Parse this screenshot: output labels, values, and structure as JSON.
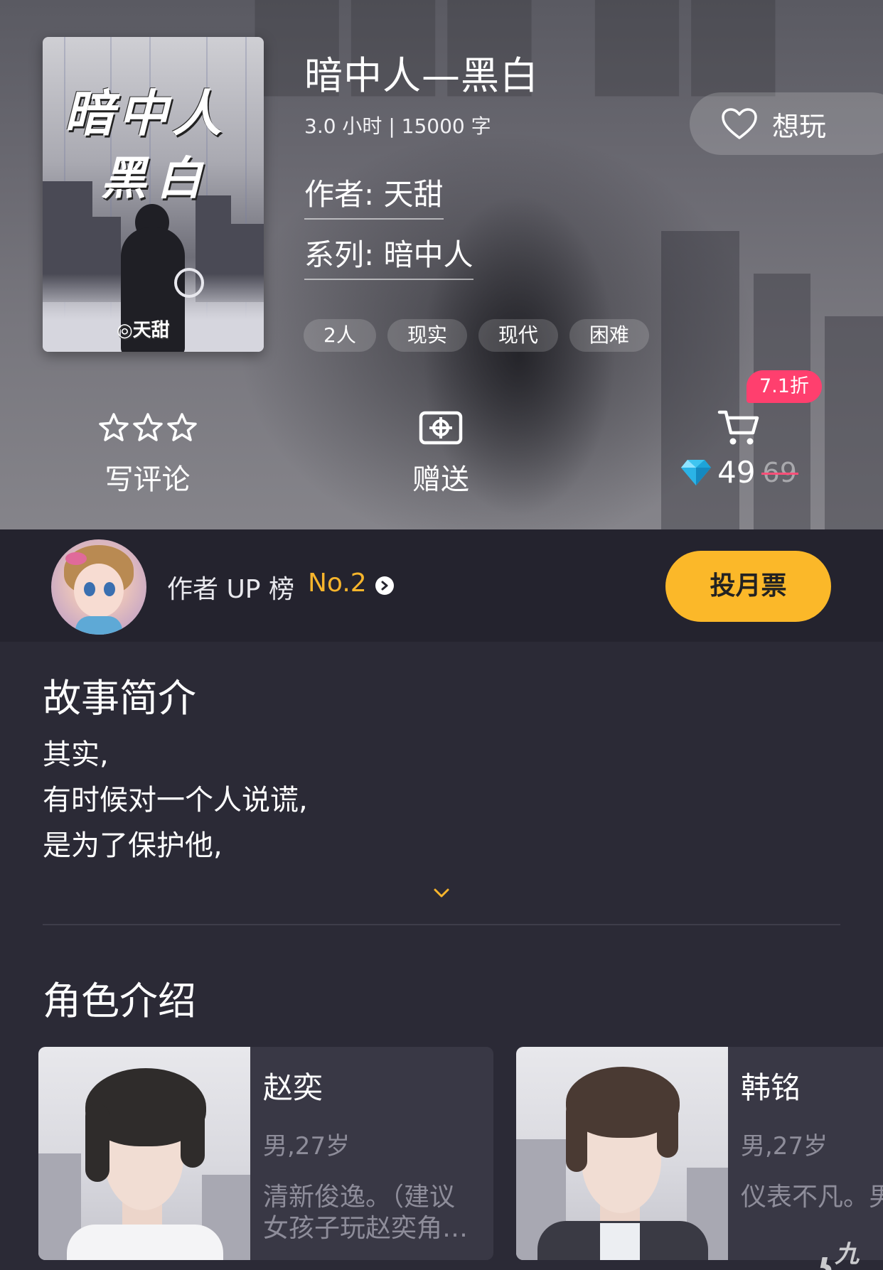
{
  "game": {
    "title": "暗中人—黑白",
    "meta": "3.0 小时 | 15000 字",
    "author": "作者: 天甜",
    "series": "系列: 暗中人",
    "cover": {
      "title_line1": "暗中人",
      "title_line2": "黑白",
      "author_mark": "◎天甜"
    },
    "tags": [
      "2人",
      "现实",
      "现代",
      "困难"
    ]
  },
  "want_button": {
    "label": "想玩",
    "icon": "heart-icon"
  },
  "actions": {
    "review": {
      "label": "写评论",
      "icon": "three-stars-icon"
    },
    "gift": {
      "label": "赠送",
      "icon": "gift-ticket-icon"
    },
    "buy": {
      "icon": "cart-icon",
      "currency_icon": "diamond-icon",
      "price": "49",
      "original_price": "69",
      "discount": "7.1折"
    }
  },
  "rank": {
    "label": "作者 UP 榜",
    "position": "No.2",
    "vote_label": "投月票"
  },
  "story": {
    "heading": "故事简介",
    "lines": [
      "其实,",
      "有时候对一个人说谎,",
      "是为了保护他,"
    ]
  },
  "roles": {
    "heading": "角色介绍",
    "items": [
      {
        "name": "赵奕",
        "info": "男,27岁",
        "desc": "清新俊逸。（建议女孩子玩赵奕角色）"
      },
      {
        "name": "韩铭",
        "info": "男,27岁",
        "desc": "仪表不凡。男"
      }
    ]
  },
  "watermark": {
    "logo": "ʖ",
    "text": "九游"
  },
  "colors": {
    "accent_yellow": "#fbb829",
    "discount_pink": "#ff3f6e",
    "background": "#2b2a36",
    "rank_bar": "#24232e"
  }
}
